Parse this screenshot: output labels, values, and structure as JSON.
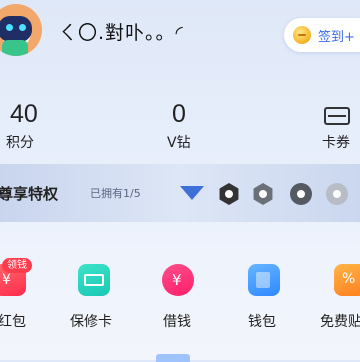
{
  "header": {
    "username": "ㄑ〇.對卟。。◜",
    "checkin_label": "签到+"
  },
  "stats": [
    {
      "value": "40",
      "label": "积分"
    },
    {
      "value": "0",
      "label": "V钻"
    },
    {
      "value": "",
      "label": "卡券"
    }
  ],
  "privileges": {
    "title": "尊享特权",
    "owned": "已拥有1/5"
  },
  "services": [
    {
      "label": "红包",
      "tag": "领钱"
    },
    {
      "label": "保修卡"
    },
    {
      "label": "借钱"
    },
    {
      "label": "钱包"
    },
    {
      "label": "免费贴"
    }
  ]
}
